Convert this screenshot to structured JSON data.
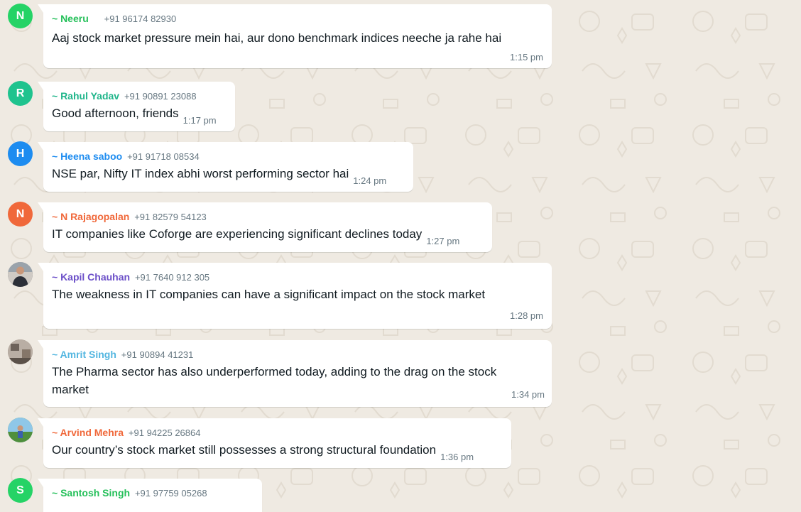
{
  "messages": [
    {
      "avatar_letter": "N",
      "avatar_color": "#25d366",
      "avatar_type": "letter",
      "sender": "~ Neeru",
      "sender_color": "#25c05a",
      "phone": "+91 96174 82930",
      "text": "Aaj stock market pressure mein hai, aur dono benchmark indices neeche ja rahe hai",
      "time": "1:15 pm"
    },
    {
      "avatar_letter": "R",
      "avatar_color": "#1fc38e",
      "avatar_type": "letter",
      "sender": "~ Rahul Yadav",
      "sender_color": "#1fb58a",
      "phone": "+91 90891 23088",
      "text": "Good afternoon, friends",
      "time": "1:17 pm"
    },
    {
      "avatar_letter": "H",
      "avatar_color": "#1d8cf0",
      "avatar_type": "letter",
      "sender": "~ Heena saboo",
      "sender_color": "#1d8cf0",
      "phone": "+91 91718 08534",
      "text": "NSE par, Nifty IT index abhi worst performing sector hai",
      "time": "1:24 pm"
    },
    {
      "avatar_letter": "N",
      "avatar_color": "#f0683a",
      "avatar_type": "letter",
      "sender": "~ N Rajagopalan",
      "sender_color": "#f0683a",
      "phone": "+91 82579 54123",
      "text": "IT companies like Coforge are experiencing significant declines today",
      "time": "1:27 pm"
    },
    {
      "avatar_letter": "",
      "avatar_color": "#5a5f66",
      "avatar_type": "photo-person",
      "sender": "~ Kapil Chauhan",
      "sender_color": "#6b4fc8",
      "phone": "+91 7640 912 305",
      "text": "The weakness in IT companies can have a significant impact on the stock market",
      "time": "1:28 pm"
    },
    {
      "avatar_letter": "",
      "avatar_color": "#8a7f76",
      "avatar_type": "photo-room",
      "sender": "~ Amrit Singh",
      "sender_color": "#53b6e0",
      "phone": "+91 90894 41231",
      "text": "The Pharma sector has also underperformed today, adding to the drag on the stock market",
      "time": "1:34 pm"
    },
    {
      "avatar_letter": "",
      "avatar_color": "#3f8f3a",
      "avatar_type": "photo-outdoor",
      "sender": "~ Arvind Mehra",
      "sender_color": "#f0683a",
      "phone": "+91 94225 26864",
      "text": "Our country’s stock market still possesses a strong structural foundation",
      "time": "1:36 pm"
    },
    {
      "avatar_letter": "S",
      "avatar_color": "#25d366",
      "avatar_type": "letter",
      "sender": "~ Santosh Singh",
      "sender_color": "#25c05a",
      "phone": "+91 97759 05268",
      "text": "",
      "time": ""
    }
  ]
}
